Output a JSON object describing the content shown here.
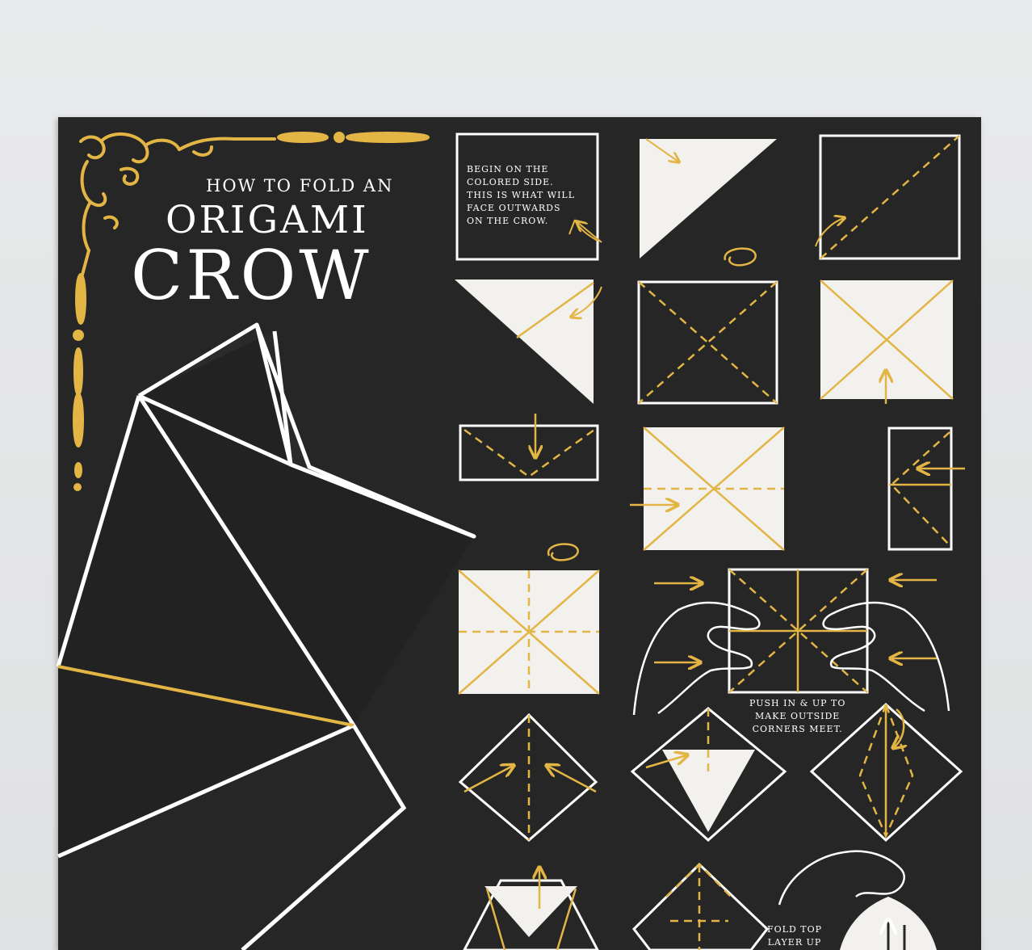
{
  "poster": {
    "title_line1": "HOW TO FOLD AN",
    "title_line2": "ORIGAMI",
    "title_line3": "CROW",
    "steps": {
      "step1_note": "BEGIN ON THE\nCOLORED SIDE.\nTHIS IS WHAT WILL\nFACE OUTWARDS\nON THE CROW.",
      "push_note": "PUSH IN & UP TO\nMAKE OUTSIDE\nCORNERS MEET.",
      "fold_note": "FOLD TOP\nLAYER UP"
    }
  },
  "colors": {
    "board": "#262626",
    "chalk": "#ffffff",
    "gold": "#e2b545",
    "wall": "#e4e5e6"
  },
  "icons": [
    "corner-ornament-icon",
    "fold-arrow-icon",
    "flip-over-icon",
    "hand-icon"
  ]
}
